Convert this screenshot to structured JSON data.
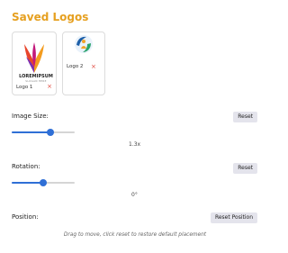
{
  "title": "Saved Logos",
  "logos": [
    {
      "label": "Logo 1",
      "brand_bold_a": "LOREM",
      "brand_bold_b": "IPSUM",
      "tagline": "SLOGAN HERE",
      "remove": "×"
    },
    {
      "label": "Logo 2",
      "remove": "×"
    }
  ],
  "image_size": {
    "label": "Image Size:",
    "reset": "Reset",
    "value": "1.3x",
    "level": 0.62
  },
  "rotation": {
    "label": "Rotation:",
    "reset": "Reset",
    "value": "0°",
    "level": 0.5
  },
  "position": {
    "label": "Position:",
    "reset": "Reset Position",
    "hint": "Drag to move, click reset to restore default placement"
  },
  "colors": {
    "accent": "#e6a020",
    "slider": "#2f6fd6",
    "remove": "#e0463c"
  }
}
